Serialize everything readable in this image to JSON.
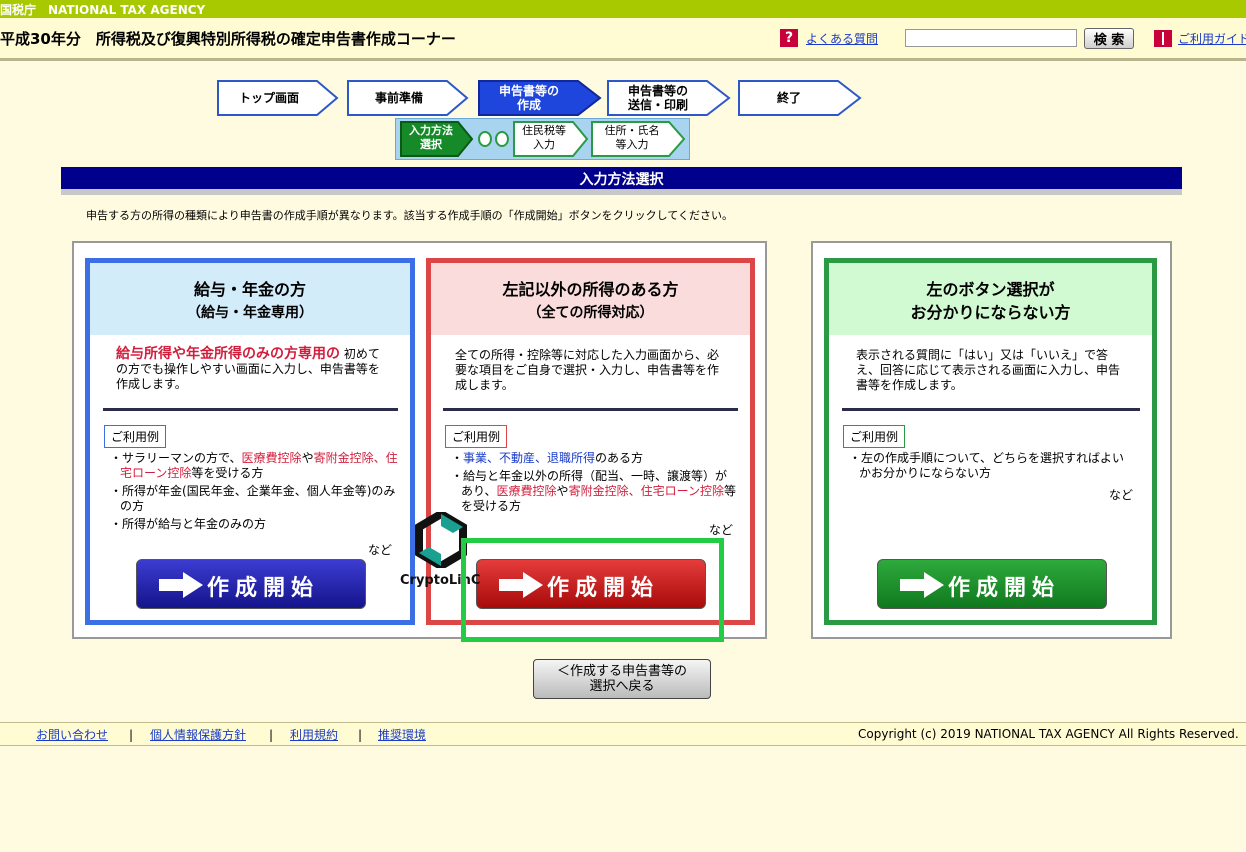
{
  "header": {
    "agency": "国税庁　NATIONAL TAX AGENCY",
    "title": "平成30年分　所得税及び復興特別所得税の確定申告書作成コーナー",
    "faq_label": "よくある質問",
    "search_value": "",
    "search_button": "検 索",
    "guide_label": "ご利用ガイド"
  },
  "steps": [
    {
      "label": "トップ画面"
    },
    {
      "label": "事前準備"
    },
    {
      "label_line1": "申告書等の",
      "label_line2": "作成"
    },
    {
      "label_line1": "申告書等の",
      "label_line2": "送信・印刷"
    },
    {
      "label": "終了"
    }
  ],
  "substeps": [
    {
      "line1": "入力方法",
      "line2": "選択"
    },
    {
      "line1": "住民税等",
      "line2": "入力"
    },
    {
      "line1": "住所・氏名",
      "line2": "等入力"
    }
  ],
  "page": {
    "heading": "入力方法選択",
    "instruction": "申告する方の所得の種類により申告書の作成手順が異なります。該当する作成手順の「作成開始」ボタンをクリックしてください。"
  },
  "cards": {
    "salary": {
      "title": "給与・年金の方",
      "subtitle": "（給与・年金専用）",
      "lead_red": "給与所得や年金所得のみの方専用の",
      "lead_rest": "初めての方でも操作しやすい画面に入力し、申告書等を作成します。",
      "tag": "ご利用例",
      "ex1_a": "サラリーマンの方で、",
      "ex1_b": "医療費控除",
      "ex1_c": "や",
      "ex1_d": "寄附金控除、住宅ローン控除",
      "ex1_e": "等を受ける方",
      "ex2": "所得が年金(国民年金、企業年金、個人年金等)のみの方",
      "ex3": "所得が給与と年金のみの方",
      "etc": "など",
      "button": "作成開始"
    },
    "other": {
      "title": "左記以外の所得のある方",
      "subtitle": "（全ての所得対応）",
      "desc": "全ての所得・控除等に対応した入力画面から、必要な項目をご自身で選択・入力し、申告書等を作成します。",
      "tag": "ご利用例",
      "ex1_a": "事業、不動産、退職所得",
      "ex1_b": "のある方",
      "ex2_a": "給与と年金以外の所得（配当、一時、譲渡等）があり、",
      "ex2_b": "医療費控除",
      "ex2_c": "や",
      "ex2_d": "寄附金控除、住宅ローン控除",
      "ex2_e": "等を受ける方",
      "etc": "など",
      "button": "作成開始"
    },
    "unsure": {
      "title_line1": "左のボタン選択が",
      "title_line2": "お分かりにならない方",
      "desc": "表示される質問に「はい」又は「いいえ」で答え、回答に応じて表示される画面に入力し、申告書等を作成します。",
      "tag": "ご利用例",
      "ex1": "左の作成手順について、どちらを選択すればよいかお分かりにならない方",
      "etc": "など",
      "button": "作成開始"
    }
  },
  "back_button_line1": "＜作成する申告書等の",
  "back_button_line2": "選択へ戻る",
  "footer": {
    "links": [
      "お問い合わせ",
      "個人情報保護方針",
      "利用規約",
      "推奨環境"
    ],
    "separator": "|",
    "copyright": "Copyright (c) 2019 NATIONAL TAX AGENCY All Rights Reserved."
  },
  "watermark": "CryptoLinC",
  "colors": {
    "agency_bar": "#a8c800",
    "banner": "#00008c",
    "salary_border": "#3c6ee6",
    "other_border": "#dc4646",
    "unsure_border": "#2a9a44",
    "highlight": "#22cc44"
  }
}
